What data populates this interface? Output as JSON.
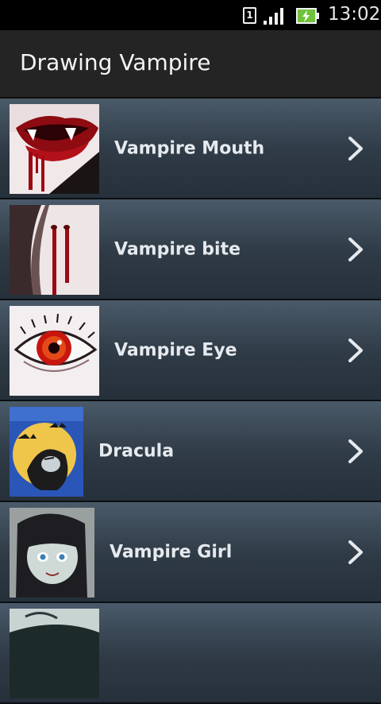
{
  "status_bar": {
    "sim_slot": "1",
    "time": "13:02",
    "icons": [
      "sim-icon",
      "signal-icon",
      "battery-charging-icon"
    ]
  },
  "app_bar": {
    "title": "Drawing Vampire"
  },
  "list": {
    "items": [
      {
        "label": "Vampire Mouth",
        "thumbnail": "vampire-mouth-thumbnail"
      },
      {
        "label": "Vampire bite",
        "thumbnail": "vampire-bite-thumbnail"
      },
      {
        "label": "Vampire Eye",
        "thumbnail": "vampire-eye-thumbnail"
      },
      {
        "label": "Dracula",
        "thumbnail": "dracula-thumbnail"
      },
      {
        "label": "Vampire Girl",
        "thumbnail": "vampire-girl-thumbnail"
      },
      {
        "label": "",
        "thumbnail": "vampire-thumbnail-partial"
      }
    ],
    "chevron_icon": "chevron-right-icon"
  }
}
